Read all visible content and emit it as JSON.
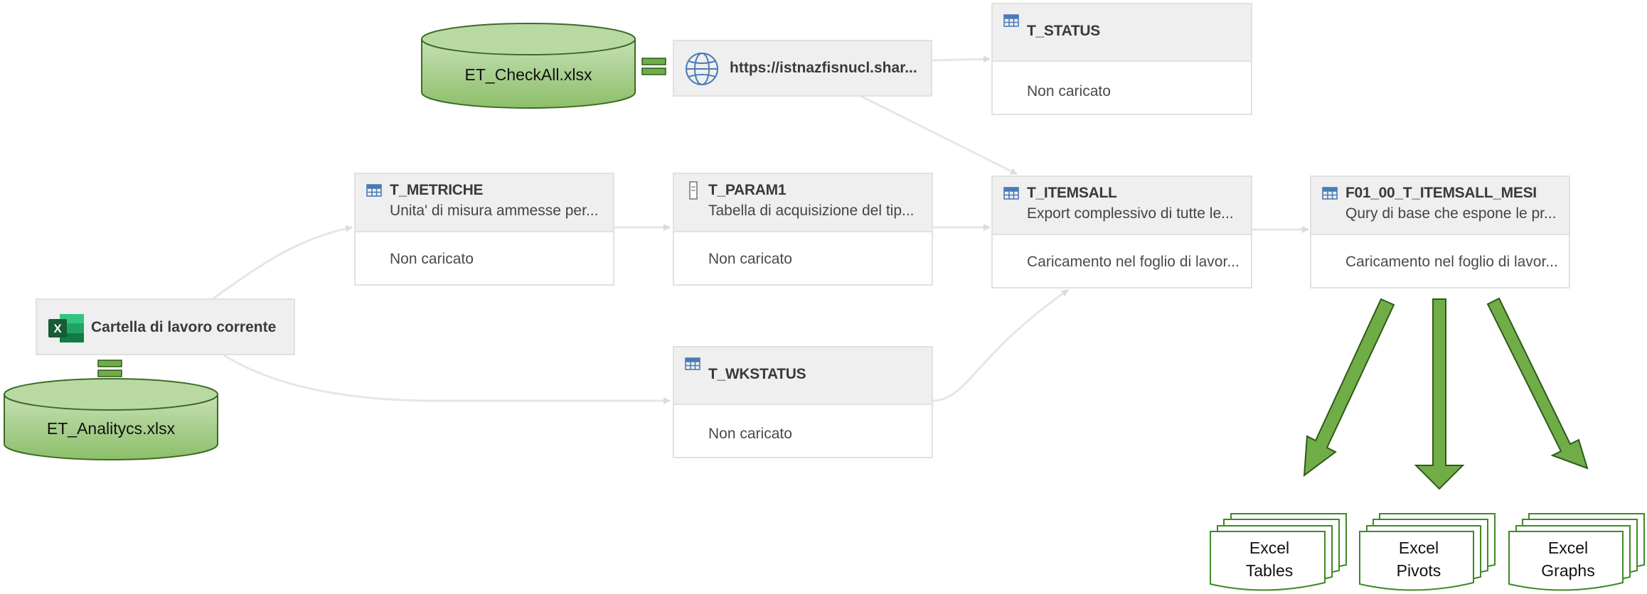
{
  "colors": {
    "accent_table_icon": "#4a7bb7",
    "excel_green": "#1d6f42",
    "db_green": "#a9d08e",
    "arrow_green": "#70ad47",
    "connector_gray": "#e6e6e6"
  },
  "databases": {
    "checkall": "ET_CheckAll.xlsx",
    "analytics": "ET_Analitycs.xlsx"
  },
  "sources": {
    "web": {
      "label": "https://istnazfisnucl.shar...",
      "icon": "globe-icon"
    },
    "workbook": {
      "label": "Cartella di lavoro corrente",
      "icon": "excel-icon"
    }
  },
  "queries": {
    "t_status": {
      "title": "T_STATUS",
      "status": "Non caricato",
      "icon": "table-icon"
    },
    "t_metriche": {
      "title": "T_METRICHE",
      "description": "Unita' di misura ammesse per...",
      "status": "Non caricato",
      "icon": "table-icon"
    },
    "t_param1": {
      "title": "T_PARAM1",
      "description": "Tabella di acquisizione del tip...",
      "status": "Non caricato",
      "icon": "parameter-icon"
    },
    "t_itemsall": {
      "title": "T_ITEMSALL",
      "description": "Export complessivo di tutte le...",
      "status": "Caricamento nel foglio di lavor...",
      "icon": "table-icon"
    },
    "f01": {
      "title": "F01_00_T_ITEMSALL_MESI",
      "description": "Qury di base che espone le pr...",
      "status": "Caricamento nel foglio di lavor...",
      "icon": "table-icon"
    },
    "t_wkstatus": {
      "title": "T_WKSTATUS",
      "status": "Non caricato",
      "icon": "table-icon"
    }
  },
  "outputs": {
    "tables": {
      "line1": "Excel",
      "line2": "Tables"
    },
    "pivots": {
      "line1": "Excel",
      "line2": "Pivots"
    },
    "graphs": {
      "line1": "Excel",
      "line2": "Graphs"
    }
  }
}
